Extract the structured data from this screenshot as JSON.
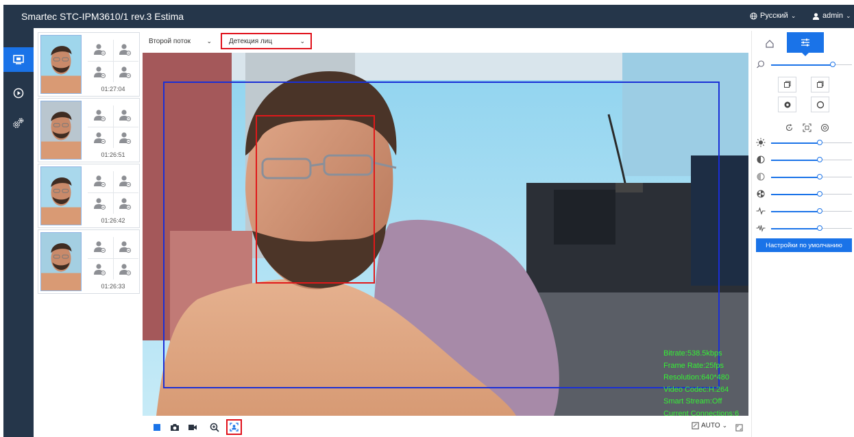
{
  "app": {
    "title": "Smartec STC-IPM3610/1 rev.3 Estima",
    "language": "Русский",
    "user": "admin"
  },
  "nav": {
    "items": [
      {
        "icon": "monitor-icon",
        "active": true
      },
      {
        "icon": "playback-icon",
        "active": false
      },
      {
        "icon": "settings-icon",
        "active": false
      }
    ]
  },
  "captures": [
    {
      "time": "01:27:04"
    },
    {
      "time": "01:26:51"
    },
    {
      "time": "01:26:42"
    },
    {
      "time": "01:26:33"
    }
  ],
  "controls": {
    "stream_select": "Второй поток",
    "mode_select": "Детекция лиц"
  },
  "video": {
    "stats": [
      "Bitrate:538.5kbps",
      "Frame Rate:25fps",
      "Resolution:640*480",
      "Video Codec:H.264",
      "Smart Stream:Off",
      "Current Connections:6"
    ]
  },
  "toolbar": {
    "auto_label": "AUTO"
  },
  "right_panel": {
    "default_button": "Настройки по умолчанию",
    "sliders": {
      "zoom": 0.76,
      "brightness": 0.6,
      "contrast": 0.6,
      "saturation": 0.6,
      "sharpness": 0.6,
      "noise": 0.6,
      "wdr": 0.6
    }
  },
  "colors": {
    "header_bg": "#25364a",
    "accent": "#1a73e8",
    "highlight": "#e0101a",
    "stats_text": "#35f235",
    "body_box": "#1a2fd6",
    "face_box": "#e0181a"
  }
}
